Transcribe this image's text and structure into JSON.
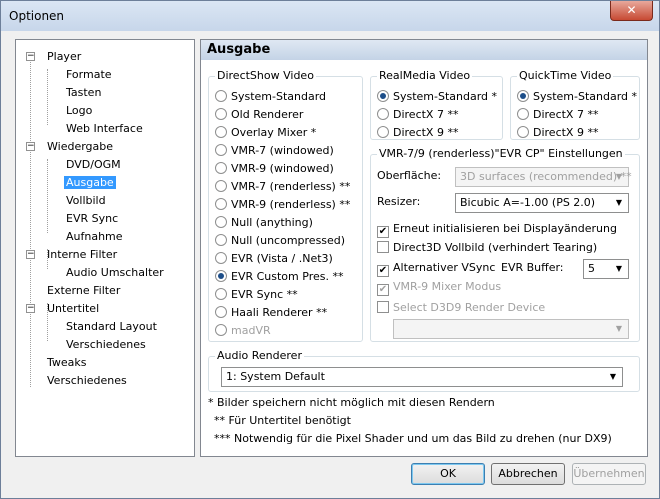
{
  "window": {
    "title": "Optionen",
    "close_glyph": "✕"
  },
  "tree": {
    "expander_minus": "−",
    "items": [
      {
        "label": "Player"
      },
      {
        "label": "Formate"
      },
      {
        "label": "Tasten"
      },
      {
        "label": "Logo"
      },
      {
        "label": "Web Interface"
      },
      {
        "label": "Wiedergabe"
      },
      {
        "label": "DVD/OGM"
      },
      {
        "label": "Ausgabe"
      },
      {
        "label": "Vollbild"
      },
      {
        "label": "EVR Sync"
      },
      {
        "label": "Aufnahme"
      },
      {
        "label": "Interne Filter"
      },
      {
        "label": "Audio Umschalter"
      },
      {
        "label": "Externe Filter"
      },
      {
        "label": "Untertitel"
      },
      {
        "label": "Standard Layout"
      },
      {
        "label": "Verschiedenes"
      },
      {
        "label": "Tweaks"
      },
      {
        "label": "Verschiedenes"
      }
    ],
    "selected": "Ausgabe"
  },
  "panel": {
    "title": "Ausgabe"
  },
  "directshow": {
    "label": "DirectShow Video",
    "options": [
      "System-Standard",
      "Old Renderer",
      "Overlay Mixer *",
      "VMR-7 (windowed)",
      "VMR-9 (windowed)",
      "VMR-7 (renderless) **",
      "VMR-9 (renderless) **",
      "Null (anything)",
      "Null (uncompressed)",
      "EVR (Vista / .Net3)",
      "EVR Custom Pres. **",
      "EVR Sync **",
      "Haali Renderer **",
      "madVR"
    ],
    "selected": "EVR Custom Pres. **"
  },
  "realmedia": {
    "label": "RealMedia Video",
    "options": [
      "System-Standard *",
      "DirectX 7 **",
      "DirectX 9 **"
    ],
    "selected": "System-Standard *"
  },
  "quicktime": {
    "label": "QuickTime Video",
    "options": [
      "System-Standard *",
      "DirectX 7 **",
      "DirectX 9 **"
    ],
    "selected": "System-Standard *"
  },
  "vmr": {
    "label": "VMR-7/9 (renderless)\"EVR CP\" Einstellungen",
    "surface_label": "Oberfläche:",
    "surface_value": "3D surfaces (recommended) **",
    "resizer_label": "Resizer:",
    "resizer_value": "Bicubic A=-1.00 (PS 2.0)",
    "check_reinit": "Erneut initialisieren bei Displayänderung",
    "check_d3d": "Direct3D Vollbild (verhindert Tearing)",
    "check_vsync": "Alternativer VSync",
    "evr_buffer_label": "EVR Buffer:",
    "evr_buffer_value": "5",
    "check_mixer": "VMR-9 Mixer Modus",
    "check_device": "Select D3D9 Render Device",
    "device_value": ""
  },
  "audio": {
    "label": "Audio Renderer",
    "value": "1: System Default"
  },
  "notes": [
    "* Bilder speichern nicht möglich mit diesen Rendern",
    "** Für Untertitel benötigt",
    "*** Notwendig für die Pixel Shader und um das Bild zu drehen (nur DX9)"
  ],
  "buttons": {
    "ok": "OK",
    "cancel": "Abbrechen",
    "apply": "Übernehmen"
  },
  "glyphs": {
    "check": "✔",
    "dropdown": "▼"
  }
}
